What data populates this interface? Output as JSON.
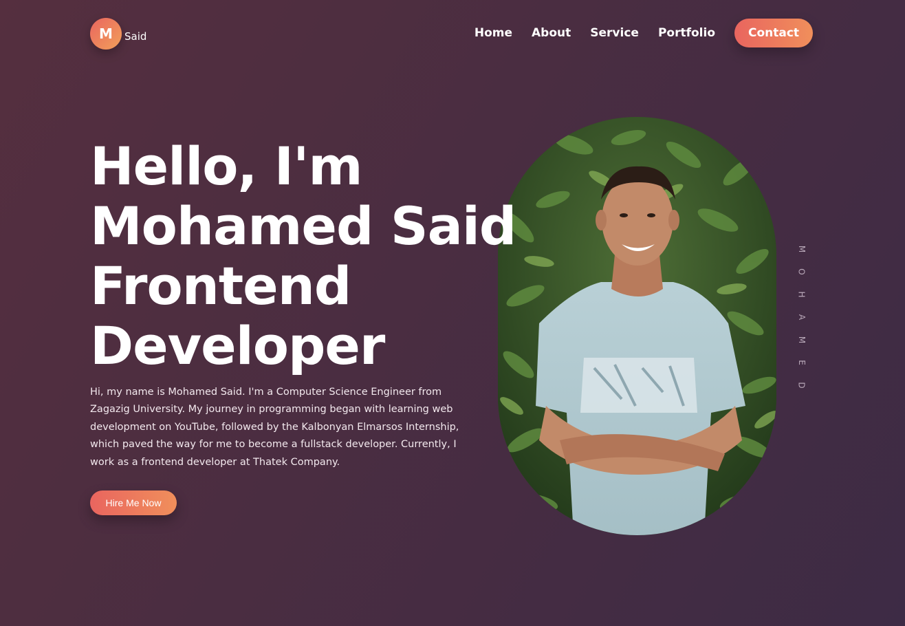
{
  "header": {
    "logo_letter": "M",
    "logo_text": "Said",
    "nav": [
      {
        "label": "Home"
      },
      {
        "label": "About"
      },
      {
        "label": "Service"
      },
      {
        "label": "Portfolio"
      }
    ],
    "contact_label": "Contact"
  },
  "hero": {
    "title_lines": [
      "Hello, I'm",
      "Mohamed Said",
      "Frontend",
      "Developer"
    ],
    "description": "Hi, my name is Mohamed Said. I'm a Computer Science Engineer from Zagazig University. My journey in programming began with learning web development on YouTube, followed by the Kalbonyan Elmarsos Internship, which paved the way for me to become a fullstack developer. Currently, I work as a frontend developer at Thatek Company.",
    "cta_label": "Hire Me Now"
  },
  "side_text": {
    "letters": [
      "M",
      "O",
      "H",
      "A",
      "M",
      "E",
      "D"
    ]
  },
  "colors": {
    "accent_start": "#e9655f",
    "accent_end": "#f08f5b",
    "background": "#4a2d41"
  }
}
